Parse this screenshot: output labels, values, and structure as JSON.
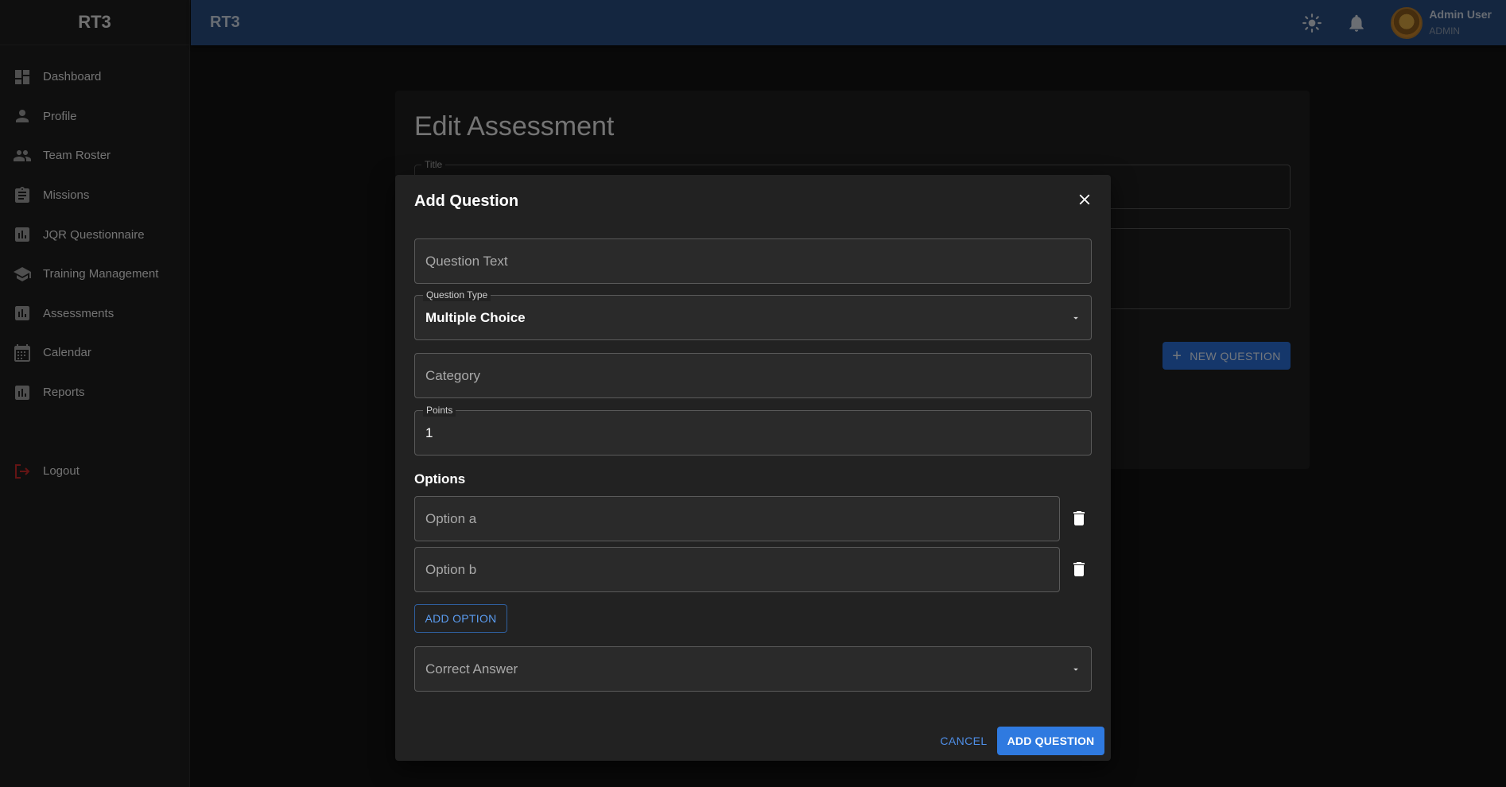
{
  "sidebar": {
    "brand": "RT3",
    "items": [
      {
        "label": "Dashboard",
        "icon": "dashboard-icon"
      },
      {
        "label": "Profile",
        "icon": "person-icon"
      },
      {
        "label": "Team Roster",
        "icon": "people-icon"
      },
      {
        "label": "Missions",
        "icon": "clipboard-icon"
      },
      {
        "label": "JQR Questionnaire",
        "icon": "bar-chart-icon"
      },
      {
        "label": "Training Management",
        "icon": "school-icon"
      },
      {
        "label": "Assessments",
        "icon": "bar-chart-icon"
      },
      {
        "label": "Calendar",
        "icon": "calendar-icon"
      },
      {
        "label": "Reports",
        "icon": "bar-chart-icon"
      }
    ],
    "logout": {
      "label": "Logout",
      "icon": "logout-icon"
    }
  },
  "appbar": {
    "title": "RT3",
    "user": {
      "name": "Admin User",
      "role": "ADMIN"
    },
    "icons": [
      "theme-toggle-sun-icon",
      "notifications-bell-icon"
    ]
  },
  "page": {
    "title": "Edit Assessment",
    "title_field_label": "Title",
    "new_question_label": "NEW QUESTION"
  },
  "dialog": {
    "title": "Add Question",
    "question_text": {
      "placeholder": "Question Text",
      "value": ""
    },
    "question_type": {
      "label": "Question Type",
      "value": "Multiple Choice"
    },
    "category": {
      "placeholder": "Category",
      "value": ""
    },
    "points": {
      "label": "Points",
      "value": "1"
    },
    "options_heading": "Options",
    "options": [
      {
        "placeholder": "Option a",
        "value": ""
      },
      {
        "placeholder": "Option b",
        "value": ""
      }
    ],
    "add_option_label": "ADD OPTION",
    "correct_answer": {
      "placeholder": "Correct Answer"
    },
    "cancel_label": "CANCEL",
    "submit_label": "ADD QUESTION"
  },
  "colors": {
    "appbar": "#284c80",
    "sidebar": "#1e1e1e",
    "background": "#121212",
    "dialog": "#222222",
    "primary": "#2f7ae0",
    "logout_icon": "#c62828"
  }
}
